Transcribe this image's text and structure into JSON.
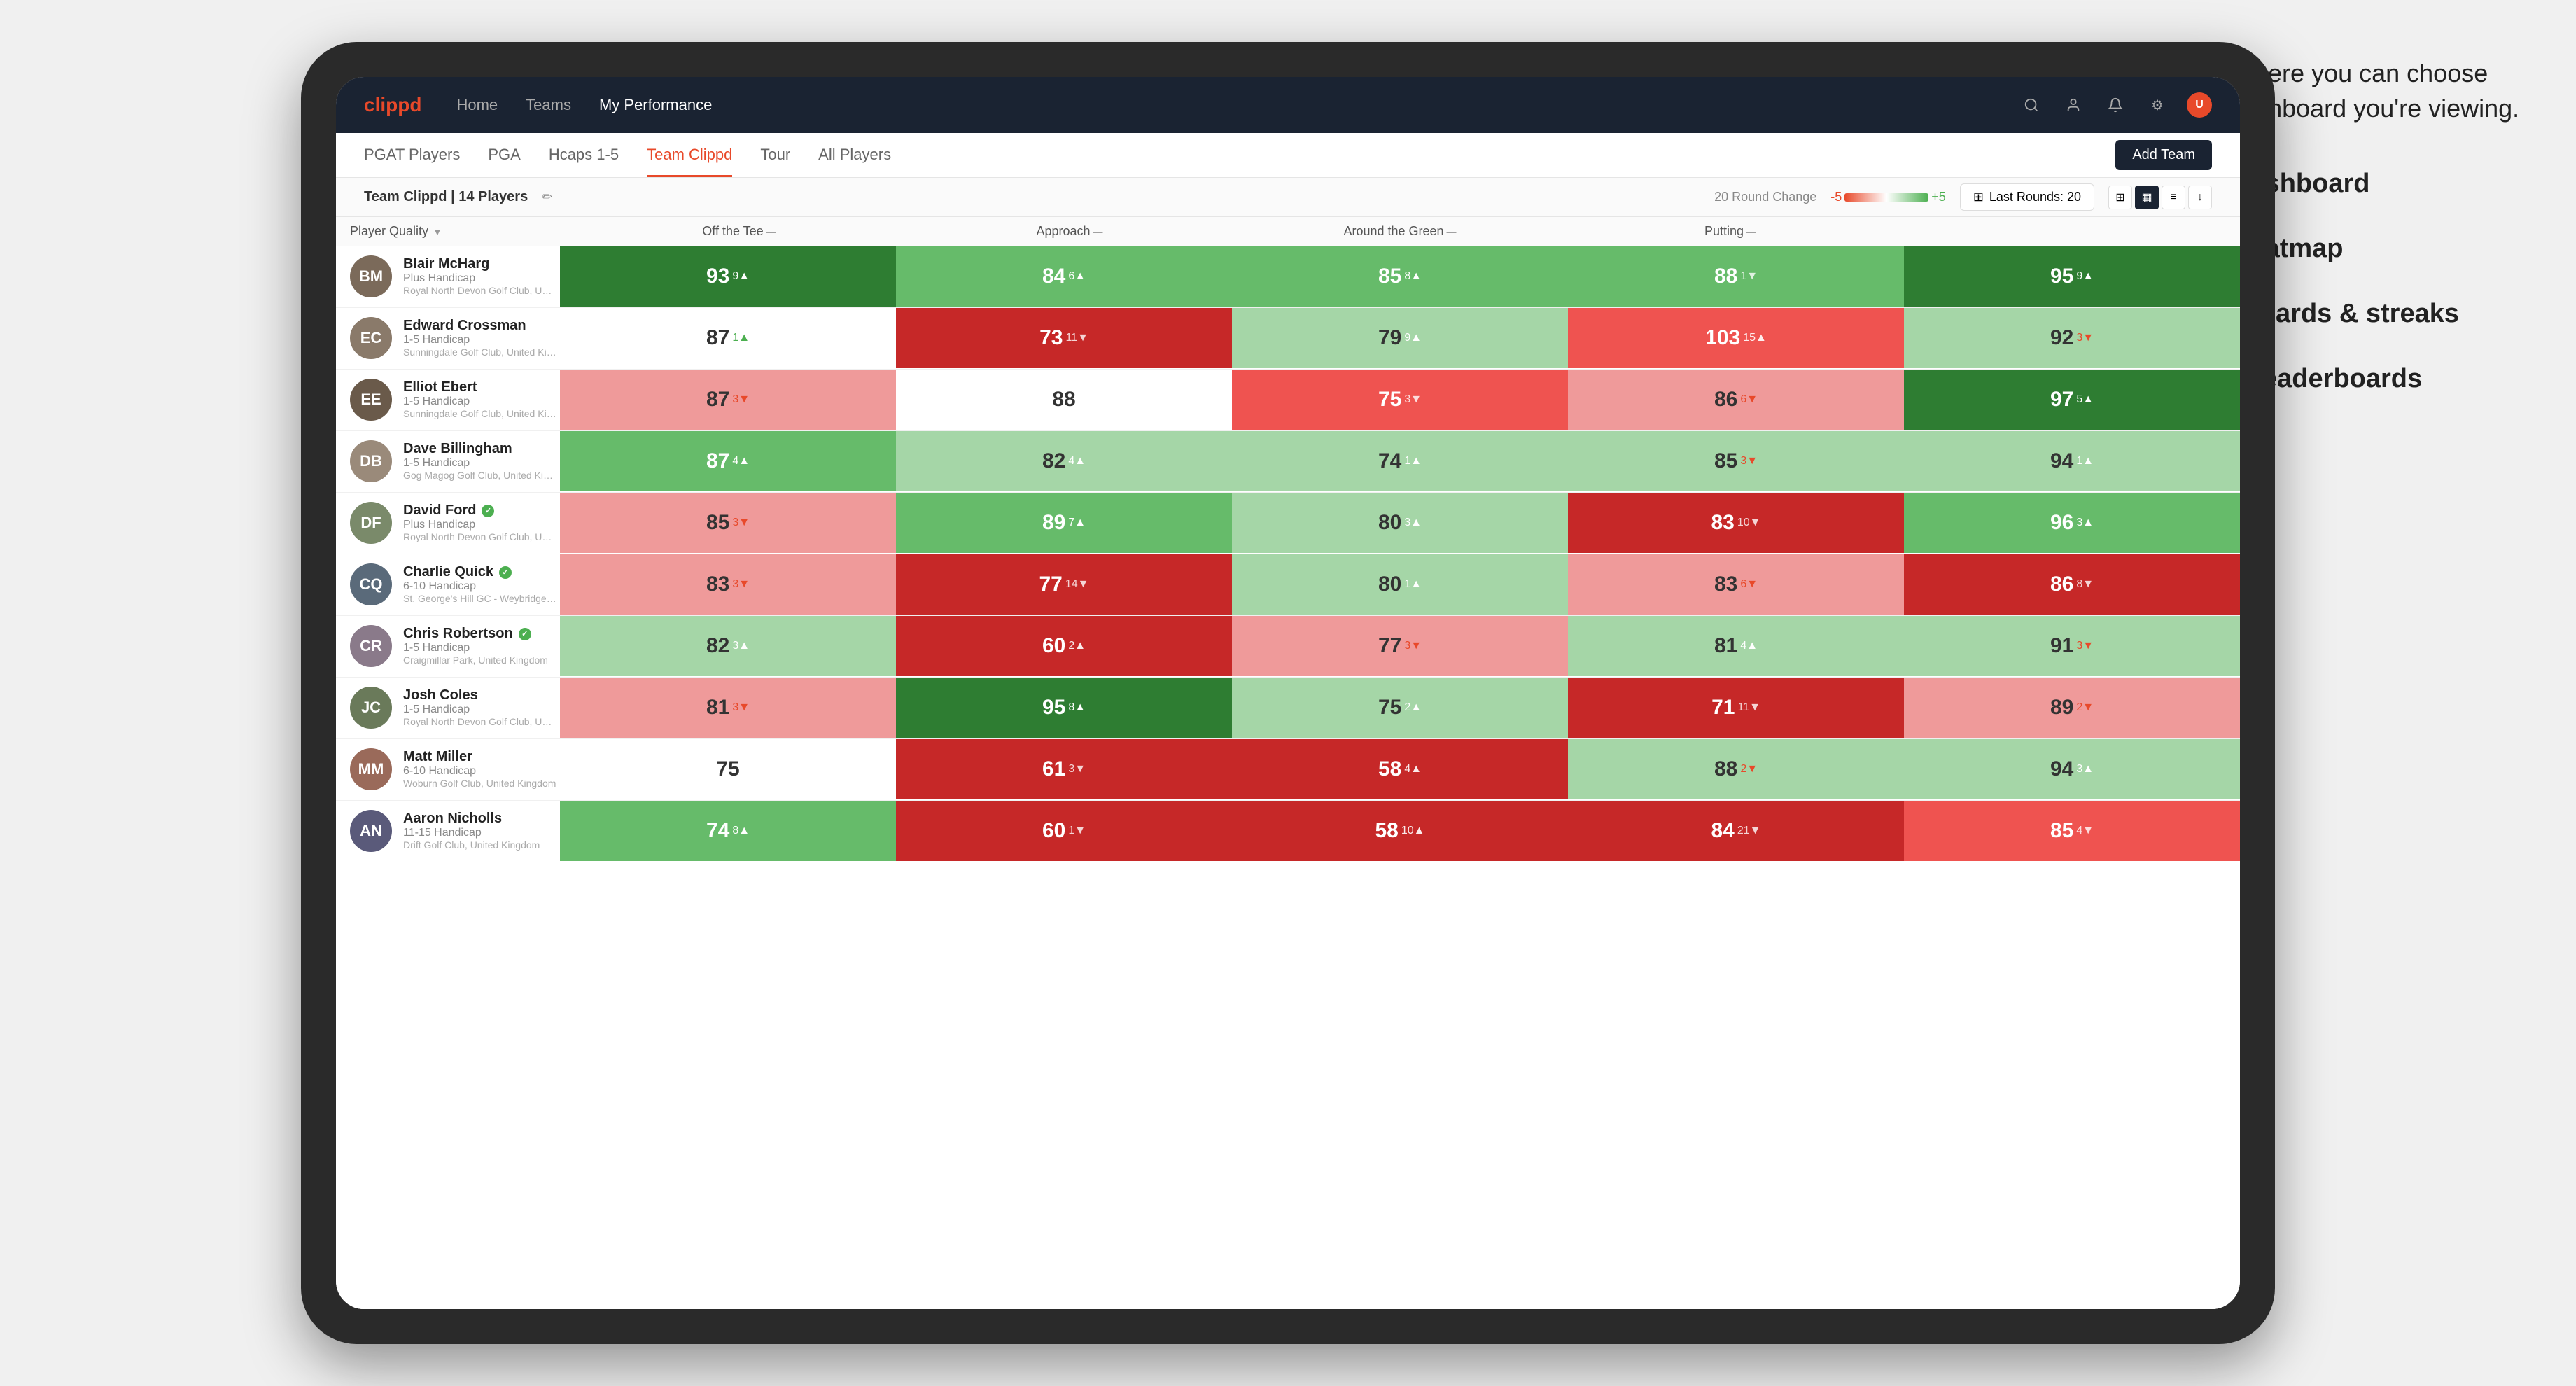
{
  "annotation": {
    "intro": "This is where you can choose which dashboard you're viewing.",
    "items": [
      {
        "label": "Team Dashboard"
      },
      {
        "label": "Team Heatmap"
      },
      {
        "label": "Leaderboards & streaks"
      },
      {
        "label": "Course leaderboards"
      }
    ]
  },
  "topnav": {
    "logo": "clippd",
    "links": [
      "Home",
      "Teams",
      "My Performance"
    ]
  },
  "subnav": {
    "tabs": [
      "PGAT Players",
      "PGA",
      "Hcaps 1-5",
      "Team Clippd",
      "Tour",
      "All Players"
    ],
    "active": "Team Clippd",
    "add_button": "Add Team"
  },
  "teambar": {
    "team_label": "Team Clippd",
    "player_count": "14 Players",
    "round_change_label": "20 Round Change",
    "scale_neg": "-5",
    "scale_pos": "+5",
    "last_rounds_label": "Last Rounds:",
    "last_rounds_value": "20"
  },
  "columns": {
    "player": "Player Quality",
    "off_tee": "Off the Tee",
    "approach": "Approach",
    "around_green": "Around the Green",
    "putting": "Putting"
  },
  "players": [
    {
      "name": "Blair McHarg",
      "handicap": "Plus Handicap",
      "club": "Royal North Devon Golf Club, United Kingdom",
      "initials": "BM",
      "avatar_color": "#7b6a5a",
      "scores": {
        "quality": {
          "val": "93",
          "change": "9",
          "dir": "up",
          "bg": "cell-green-strong"
        },
        "off_tee": {
          "val": "84",
          "change": "6",
          "dir": "up",
          "bg": "cell-green-medium"
        },
        "approach": {
          "val": "85",
          "change": "8",
          "dir": "up",
          "bg": "cell-green-medium"
        },
        "around": {
          "val": "88",
          "change": "1",
          "dir": "down",
          "bg": "cell-green-medium"
        },
        "putting": {
          "val": "95",
          "change": "9",
          "dir": "up",
          "bg": "cell-green-strong"
        }
      }
    },
    {
      "name": "Edward Crossman",
      "handicap": "1-5 Handicap",
      "club": "Sunningdale Golf Club, United Kingdom",
      "initials": "EC",
      "avatar_color": "#8a7a6a",
      "scores": {
        "quality": {
          "val": "87",
          "change": "1",
          "dir": "up",
          "bg": "cell-white"
        },
        "off_tee": {
          "val": "73",
          "change": "11",
          "dir": "down",
          "bg": "cell-red-strong"
        },
        "approach": {
          "val": "79",
          "change": "9",
          "dir": "up",
          "bg": "cell-green-light"
        },
        "around": {
          "val": "103",
          "change": "15",
          "dir": "up",
          "bg": "cell-red-medium"
        },
        "putting": {
          "val": "92",
          "change": "3",
          "dir": "down",
          "bg": "cell-green-light"
        }
      }
    },
    {
      "name": "Elliot Ebert",
      "handicap": "1-5 Handicap",
      "club": "Sunningdale Golf Club, United Kingdom",
      "initials": "EE",
      "avatar_color": "#6a5a4a",
      "scores": {
        "quality": {
          "val": "87",
          "change": "3",
          "dir": "down",
          "bg": "cell-red-light"
        },
        "off_tee": {
          "val": "88",
          "change": "",
          "dir": "",
          "bg": "cell-white"
        },
        "approach": {
          "val": "75",
          "change": "3",
          "dir": "down",
          "bg": "cell-red-medium"
        },
        "around": {
          "val": "86",
          "change": "6",
          "dir": "down",
          "bg": "cell-red-light"
        },
        "putting": {
          "val": "97",
          "change": "5",
          "dir": "up",
          "bg": "cell-green-strong"
        }
      }
    },
    {
      "name": "Dave Billingham",
      "handicap": "1-5 Handicap",
      "club": "Gog Magog Golf Club, United Kingdom",
      "initials": "DB",
      "avatar_color": "#9a8a7a",
      "scores": {
        "quality": {
          "val": "87",
          "change": "4",
          "dir": "up",
          "bg": "cell-green-medium"
        },
        "off_tee": {
          "val": "82",
          "change": "4",
          "dir": "up",
          "bg": "cell-green-light"
        },
        "approach": {
          "val": "74",
          "change": "1",
          "dir": "up",
          "bg": "cell-green-light"
        },
        "around": {
          "val": "85",
          "change": "3",
          "dir": "down",
          "bg": "cell-green-light"
        },
        "putting": {
          "val": "94",
          "change": "1",
          "dir": "up",
          "bg": "cell-green-light"
        }
      }
    },
    {
      "name": "David Ford",
      "handicap": "Plus Handicap",
      "club": "Royal North Devon Golf Club, United Kingdom",
      "initials": "DF",
      "verified": true,
      "avatar_color": "#7a8a6a",
      "scores": {
        "quality": {
          "val": "85",
          "change": "3",
          "dir": "down",
          "bg": "cell-red-light"
        },
        "off_tee": {
          "val": "89",
          "change": "7",
          "dir": "up",
          "bg": "cell-green-medium"
        },
        "approach": {
          "val": "80",
          "change": "3",
          "dir": "up",
          "bg": "cell-green-light"
        },
        "around": {
          "val": "83",
          "change": "10",
          "dir": "down",
          "bg": "cell-red-strong"
        },
        "putting": {
          "val": "96",
          "change": "3",
          "dir": "up",
          "bg": "cell-green-medium"
        }
      }
    },
    {
      "name": "Charlie Quick",
      "handicap": "6-10 Handicap",
      "club": "St. George's Hill GC - Weybridge - Surrey, Uni...",
      "initials": "CQ",
      "verified": true,
      "avatar_color": "#5a6a7a",
      "scores": {
        "quality": {
          "val": "83",
          "change": "3",
          "dir": "down",
          "bg": "cell-red-light"
        },
        "off_tee": {
          "val": "77",
          "change": "14",
          "dir": "down",
          "bg": "cell-red-strong"
        },
        "approach": {
          "val": "80",
          "change": "1",
          "dir": "up",
          "bg": "cell-green-light"
        },
        "around": {
          "val": "83",
          "change": "6",
          "dir": "down",
          "bg": "cell-red-light"
        },
        "putting": {
          "val": "86",
          "change": "8",
          "dir": "down",
          "bg": "cell-red-strong"
        }
      }
    },
    {
      "name": "Chris Robertson",
      "handicap": "1-5 Handicap",
      "club": "Craigmillar Park, United Kingdom",
      "initials": "CR",
      "verified": true,
      "avatar_color": "#8a7a8a",
      "scores": {
        "quality": {
          "val": "82",
          "change": "3",
          "dir": "up",
          "bg": "cell-green-light"
        },
        "off_tee": {
          "val": "60",
          "change": "2",
          "dir": "up",
          "bg": "cell-red-strong"
        },
        "approach": {
          "val": "77",
          "change": "3",
          "dir": "down",
          "bg": "cell-red-light"
        },
        "around": {
          "val": "81",
          "change": "4",
          "dir": "up",
          "bg": "cell-green-light"
        },
        "putting": {
          "val": "91",
          "change": "3",
          "dir": "down",
          "bg": "cell-green-light"
        }
      }
    },
    {
      "name": "Josh Coles",
      "handicap": "1-5 Handicap",
      "club": "Royal North Devon Golf Club, United Kingdom",
      "initials": "JC",
      "avatar_color": "#6a7a5a",
      "scores": {
        "quality": {
          "val": "81",
          "change": "3",
          "dir": "down",
          "bg": "cell-red-light"
        },
        "off_tee": {
          "val": "95",
          "change": "8",
          "dir": "up",
          "bg": "cell-green-strong"
        },
        "approach": {
          "val": "75",
          "change": "2",
          "dir": "up",
          "bg": "cell-green-light"
        },
        "around": {
          "val": "71",
          "change": "11",
          "dir": "down",
          "bg": "cell-red-strong"
        },
        "putting": {
          "val": "89",
          "change": "2",
          "dir": "down",
          "bg": "cell-red-light"
        }
      }
    },
    {
      "name": "Matt Miller",
      "handicap": "6-10 Handicap",
      "club": "Woburn Golf Club, United Kingdom",
      "initials": "MM",
      "avatar_color": "#9a6a5a",
      "scores": {
        "quality": {
          "val": "75",
          "change": "",
          "dir": "",
          "bg": "cell-white"
        },
        "off_tee": {
          "val": "61",
          "change": "3",
          "dir": "down",
          "bg": "cell-red-strong"
        },
        "approach": {
          "val": "58",
          "change": "4",
          "dir": "up",
          "bg": "cell-red-strong"
        },
        "around": {
          "val": "88",
          "change": "2",
          "dir": "down",
          "bg": "cell-green-light"
        },
        "putting": {
          "val": "94",
          "change": "3",
          "dir": "up",
          "bg": "cell-green-light"
        }
      }
    },
    {
      "name": "Aaron Nicholls",
      "handicap": "11-15 Handicap",
      "club": "Drift Golf Club, United Kingdom",
      "initials": "AN",
      "avatar_color": "#5a5a7a",
      "scores": {
        "quality": {
          "val": "74",
          "change": "8",
          "dir": "up",
          "bg": "cell-green-medium"
        },
        "off_tee": {
          "val": "60",
          "change": "1",
          "dir": "down",
          "bg": "cell-red-strong"
        },
        "approach": {
          "val": "58",
          "change": "10",
          "dir": "up",
          "bg": "cell-red-strong"
        },
        "around": {
          "val": "84",
          "change": "21",
          "dir": "down",
          "bg": "cell-red-strong"
        },
        "putting": {
          "val": "85",
          "change": "4",
          "dir": "down",
          "bg": "cell-red-medium"
        }
      }
    }
  ]
}
